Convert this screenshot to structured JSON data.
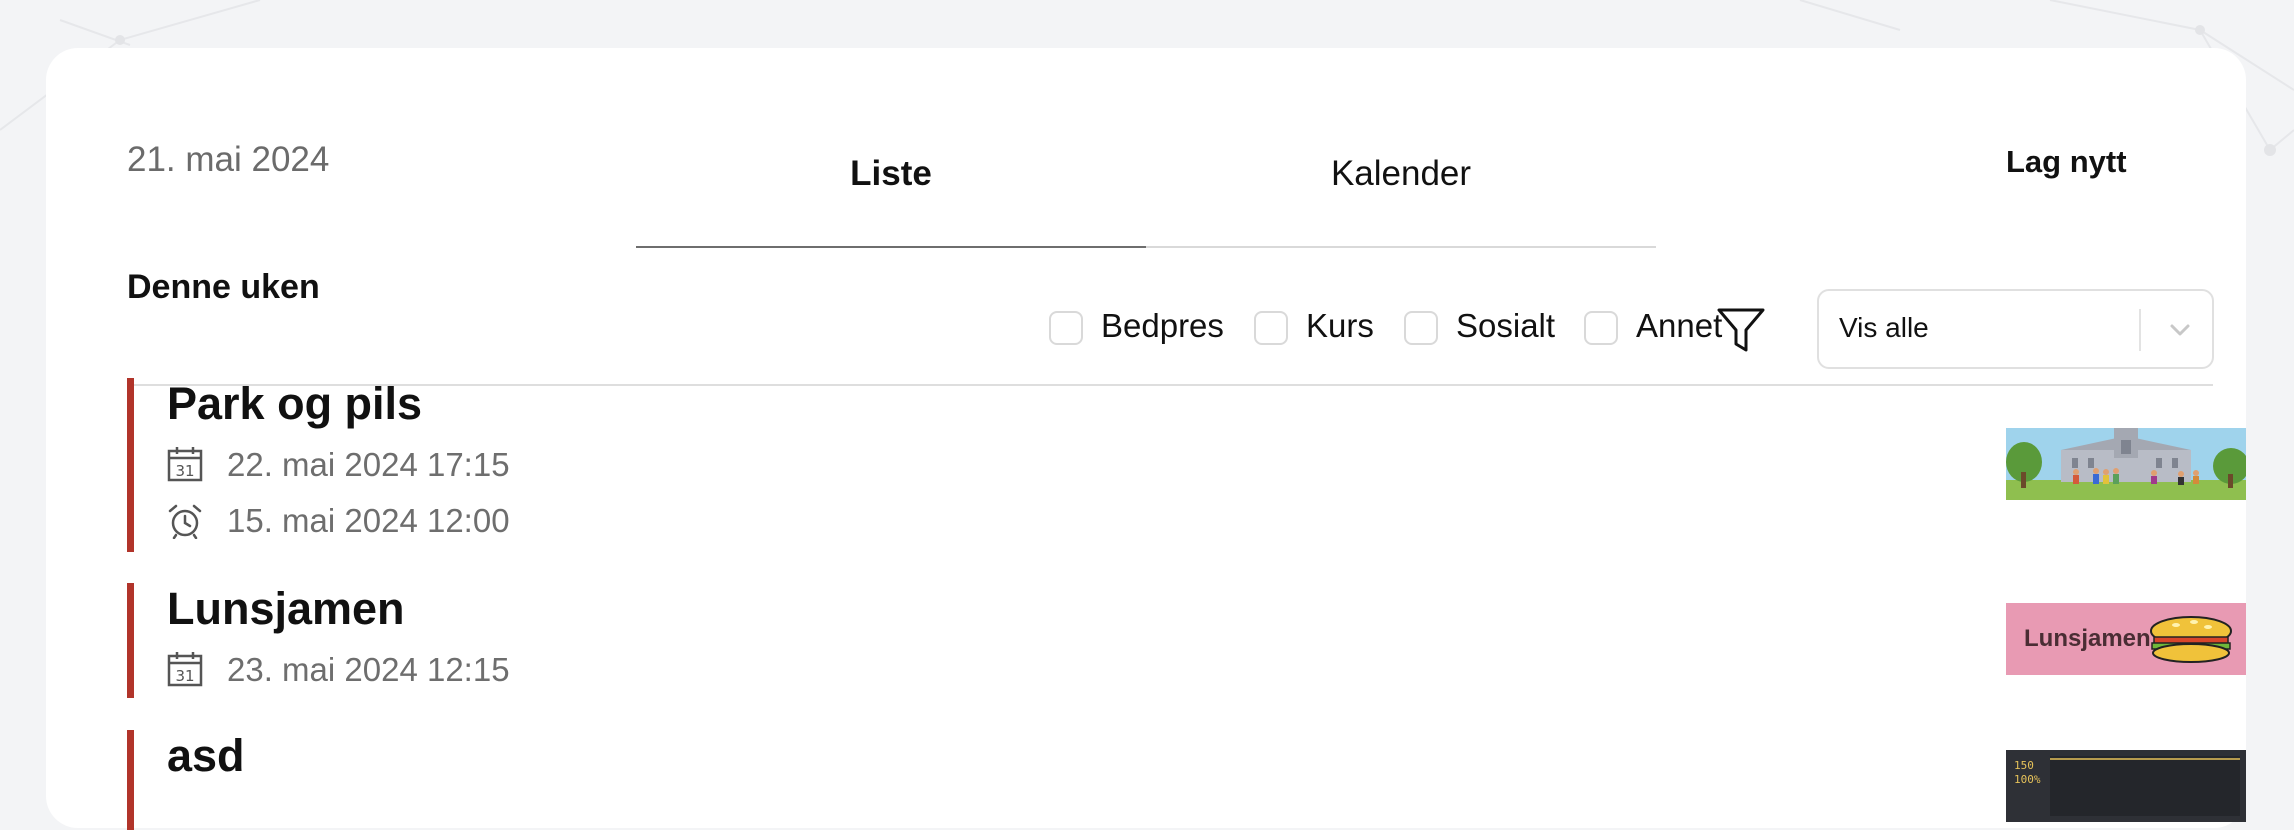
{
  "header": {
    "date": "21. mai 2024",
    "tabs": [
      {
        "label": "Liste",
        "active": true
      },
      {
        "label": "Kalender",
        "active": false
      }
    ],
    "new_button": "Lag nytt"
  },
  "section": {
    "week_label": "Denne uken"
  },
  "filters": {
    "categories": [
      {
        "label": "Bedpres",
        "checked": false
      },
      {
        "label": "Kurs",
        "checked": false
      },
      {
        "label": "Sosialt",
        "checked": false
      },
      {
        "label": "Annet",
        "checked": false
      }
    ],
    "icon": "filter-icon",
    "select": {
      "value": "Vis alle",
      "icon": "chevron-down-icon"
    }
  },
  "events": [
    {
      "title": "Park og pils",
      "event_time": "22. mai 2024 17:15",
      "registration_time": "15. mai 2024 12:00",
      "image": "park-illustration"
    },
    {
      "title": "Lunsjamen",
      "event_time": "23. mai 2024 12:15",
      "image": "lunsjamen-banner",
      "image_text": "Lunsjamen"
    },
    {
      "title": "asd",
      "image": "dark-chart-screenshot",
      "image_labels": [
        "150",
        "100%"
      ]
    }
  ],
  "colors": {
    "accent_bar": "#b1342a",
    "background": "#f3f4f6",
    "card": "#ffffff",
    "muted_text": "#6e6e6e",
    "lunsjamen_pink": "#e89ab3"
  }
}
